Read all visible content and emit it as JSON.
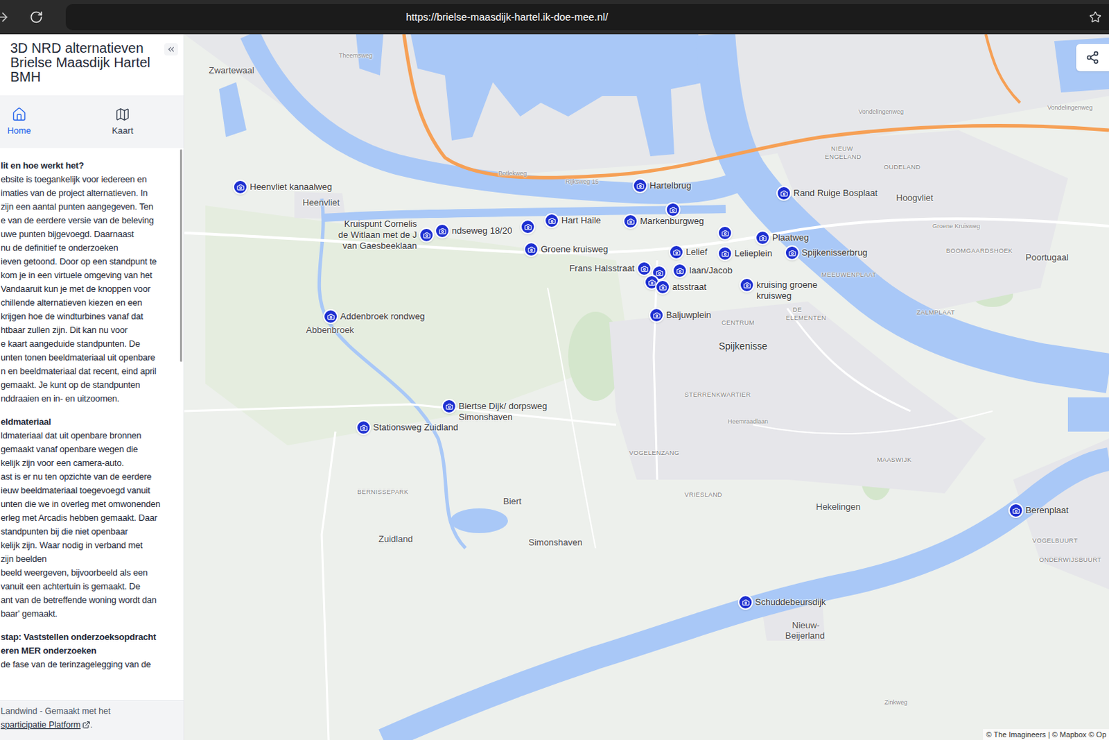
{
  "browser": {
    "url": "https://brielse-maasdijk-hartel.ik-doe-mee.nl/"
  },
  "sidebar": {
    "title": "3D NRD alternatieven Brielse Maasdijk Hartel BMH",
    "nav": [
      {
        "label": "Home",
        "selected": true
      },
      {
        "label": "Kaart",
        "selected": false
      }
    ],
    "content": [
      {
        "text": "lit en hoe werkt het?",
        "kind": "heading"
      },
      {
        "text": "ebsite is toegankelijk voor iedereen en",
        "kind": "body"
      },
      {
        "text": "imaties van de project alternatieven. In",
        "kind": "body"
      },
      {
        "text": "zijn een aantal punten aangegeven. Ten",
        "kind": "body"
      },
      {
        "text": "e van de eerdere versie van de beleving",
        "kind": "body"
      },
      {
        "text": "uwe punten bijgevoegd. Daarnaast",
        "kind": "body"
      },
      {
        "text": "nu de definitief te onderzoeken",
        "kind": "body"
      },
      {
        "text": "ieven getoond. Door op een standpunt te",
        "kind": "body"
      },
      {
        "text": "kom je in een virtuele omgeving van het",
        "kind": "body"
      },
      {
        "text": "Vandaaruit kun je met de knoppen voor",
        "kind": "body"
      },
      {
        "text": "chillende alternatieven kiezen en een",
        "kind": "body"
      },
      {
        "text": "krijgen hoe de windturbines vanaf dat",
        "kind": "body"
      },
      {
        "text": "htbaar zullen zijn. Dit kan nu voor",
        "kind": "body"
      },
      {
        "text": "e kaart aangeduide standpunten. De",
        "kind": "body"
      },
      {
        "text": "unten tonen beeldmateriaal uit openbare",
        "kind": "body"
      },
      {
        "text": "n en beeldmateriaal dat recent, eind april",
        "kind": "body"
      },
      {
        "text": "gemaakt. Je kunt op de standpunten",
        "kind": "body"
      },
      {
        "text": "nddraaien en in- en uitzoomen.",
        "kind": "body"
      },
      {
        "text": "eldmateriaal",
        "kind": "heading"
      },
      {
        "text": "ldmateriaal dat uit openbare bronnen",
        "kind": "body"
      },
      {
        "text": "gemaakt vanaf openbare wegen die",
        "kind": "body"
      },
      {
        "text": "kelijk zijn voor een camera-auto.",
        "kind": "body"
      },
      {
        "text": "ast is er nu ten opzichte van de eerdere",
        "kind": "body"
      },
      {
        "text": "ieuw beeldmateriaal toegevoegd vanuit",
        "kind": "body"
      },
      {
        "text": "unten die we in overleg met omwonenden",
        "kind": "body"
      },
      {
        "text": "erleg met Arcadis hebben gemaakt. Daar",
        "kind": "body"
      },
      {
        "text": "standpunten bij die niet openbaar",
        "kind": "body"
      },
      {
        "text": "kelijk zijn. Waar nodig in verband met",
        "kind": "body"
      },
      {
        "text": "zijn beelden",
        "kind": "body"
      },
      {
        "text": "beeld weergeven, bijvoorbeeld als een",
        "kind": "body"
      },
      {
        "text": "vanuit een achtertuin is gemaakt. De",
        "kind": "body"
      },
      {
        "text": "ant van de betreffende woning wordt dan",
        "kind": "body"
      },
      {
        "text": "baar' gemaakt.",
        "kind": "body"
      },
      {
        "text": "stap: Vaststellen onderzoeksopdracht",
        "kind": "heading"
      },
      {
        "text": "eren MER onderzoeken",
        "kind": "subheading"
      },
      {
        "text": "de fase van de terinzagelegging van de",
        "kind": "body"
      }
    ],
    "footer": {
      "text": "Landwind - Gemaakt met het",
      "link": "sparticipatie Platform",
      "end": "."
    }
  },
  "map": {
    "pins": [
      {
        "lines": [
          "Heenvliet kanaalweg"
        ]
      },
      {
        "lines": [
          "Hartelbrug"
        ]
      },
      {
        "lines": [
          "Rand Ruige Bosplaat"
        ]
      },
      {
        "lines": [
          "Kruispunt Cornelis",
          "de Witlaan met de J",
          "van Gaesbeeklaan"
        ]
      },
      {
        "lines": [
          "ndseweg 18/20"
        ]
      },
      {
        "lines": []
      },
      {
        "lines": [
          "Hart Haile"
        ]
      },
      {
        "lines": [
          "Groene kruisweg"
        ]
      },
      {
        "lines": [
          "Markenburgweg"
        ]
      },
      {
        "lines": []
      },
      {
        "lines": []
      },
      {
        "lines": [
          "Plaatweg"
        ]
      },
      {
        "lines": [
          "Lelief"
        ]
      },
      {
        "lines": [
          "Lelieplein"
        ]
      },
      {
        "lines": [
          "Spijkenisserbrug"
        ]
      },
      {
        "lines": [
          "Frans Halsstraat"
        ]
      },
      {
        "lines": []
      },
      {
        "lines": [
          "laan/Jacob"
        ]
      },
      {
        "lines": []
      },
      {
        "lines": [
          "atsstraat"
        ]
      },
      {
        "lines": [
          "kruising groene",
          "kruisweg"
        ]
      },
      {
        "lines": [
          "Baljuwplein"
        ]
      },
      {
        "lines": [
          "Addenbroek rondweg"
        ]
      },
      {
        "lines": [
          "Biertse Dijk/ dorpsweg",
          "Simonshaven"
        ]
      },
      {
        "lines": [
          "Stationsweg Zuidland"
        ]
      },
      {
        "lines": [
          "Berenplaat"
        ]
      },
      {
        "lines": [
          "Schuddebeursdijk"
        ]
      }
    ],
    "labels": [
      {
        "text": "Zwartewaal",
        "kind": "place"
      },
      {
        "text": "Heenvliet",
        "kind": "place"
      },
      {
        "text": "Hoogvliet",
        "kind": "place"
      },
      {
        "text": "Poortugaal",
        "kind": "place"
      },
      {
        "text": "Spijkenisse",
        "kind": "town"
      },
      {
        "text": "Abbenbroek",
        "kind": "place"
      },
      {
        "text": "Zuidland",
        "kind": "place"
      },
      {
        "text": "Simonshaven",
        "kind": "place"
      },
      {
        "text": "Biert",
        "kind": "place"
      },
      {
        "text": "Hekelingen",
        "kind": "place"
      },
      {
        "text": "Nieuw-",
        "kind": "place"
      },
      {
        "text": "Beijerland",
        "kind": "place"
      },
      {
        "text": "NIEUW",
        "kind": "district"
      },
      {
        "text": "ENGELAND",
        "kind": "district"
      },
      {
        "text": "OUDELAND",
        "kind": "district"
      },
      {
        "text": "BOOMGAARDSHOEK",
        "kind": "district"
      },
      {
        "text": "MEEUWENPLAAT",
        "kind": "district"
      },
      {
        "text": "ZALMPLAAT",
        "kind": "district"
      },
      {
        "text": "CENTRUM",
        "kind": "district"
      },
      {
        "text": "DE",
        "kind": "district"
      },
      {
        "text": "ELEMENTEN",
        "kind": "district"
      },
      {
        "text": "STERRENKWARTIER",
        "kind": "district"
      },
      {
        "text": "VOGELENZANG",
        "kind": "district"
      },
      {
        "text": "VRIESLAND",
        "kind": "district"
      },
      {
        "text": "MAASWIJK",
        "kind": "district"
      },
      {
        "text": "BERNISSEPARK",
        "kind": "district"
      },
      {
        "text": "VOGELBUURT",
        "kind": "district"
      },
      {
        "text": "ONDERWIJSBUURT",
        "kind": "district"
      },
      {
        "text": "Theemsweg",
        "kind": "road"
      },
      {
        "text": "Botlekweg",
        "kind": "road"
      },
      {
        "text": "Rijksweg 15",
        "kind": "road"
      },
      {
        "text": "Vondelingenweg",
        "kind": "road"
      },
      {
        "text": "Vondelingenweg",
        "kind": "road"
      },
      {
        "text": "Groene Kruisweg",
        "kind": "road"
      },
      {
        "text": "Heemraadlaan",
        "kind": "road"
      },
      {
        "text": "Zinkweg",
        "kind": "road"
      }
    ],
    "attribution": "© The Imagineers | © Mapbox © Op"
  }
}
